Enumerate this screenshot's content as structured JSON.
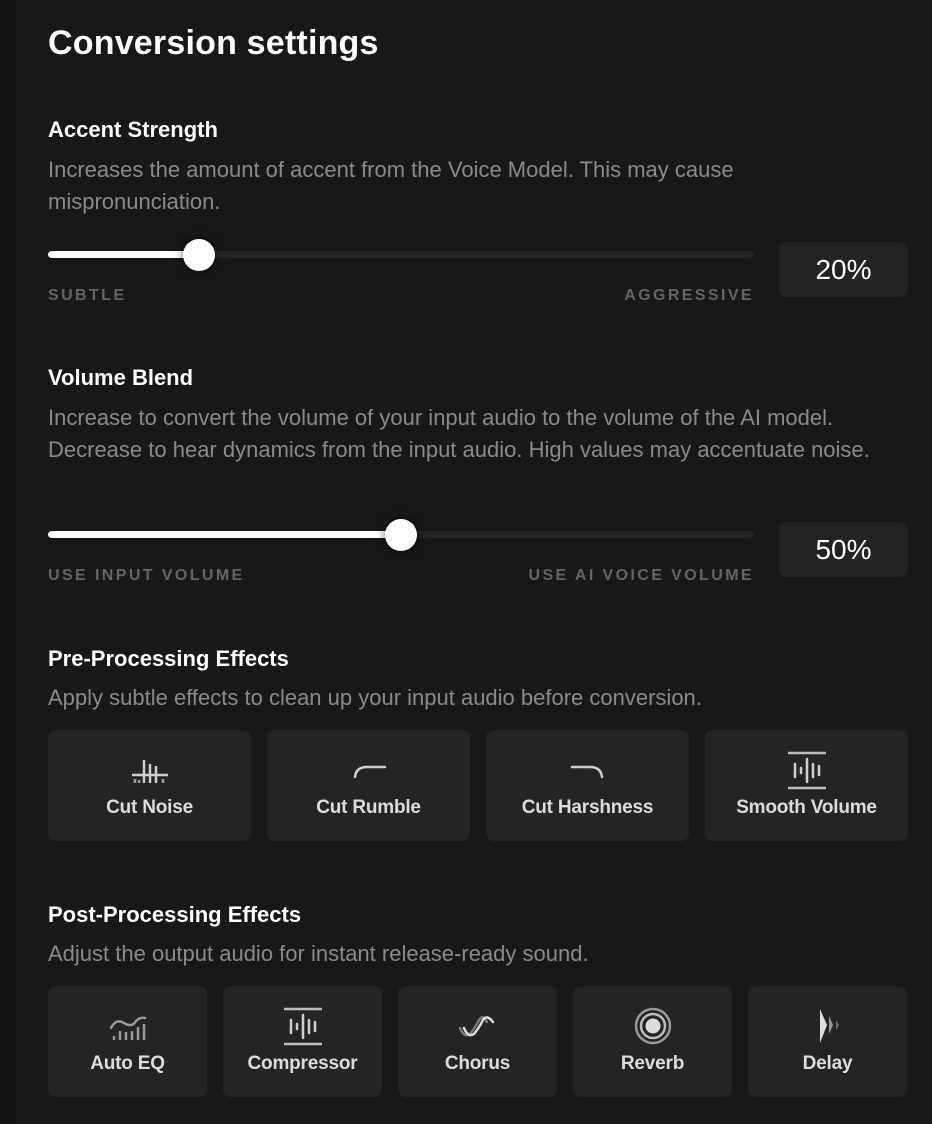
{
  "header": {
    "title": "Conversion settings"
  },
  "accent_strength": {
    "title": "Accent Strength",
    "description": "Increases the amount of accent from the Voice Model. This may cause mispronunciation.",
    "value_percent": 20,
    "value_label": "20%",
    "min_label": "SUBTLE",
    "max_label": "AGGRESSIVE"
  },
  "volume_blend": {
    "title": "Volume Blend",
    "description": "Increase to convert the volume of your input audio to the volume of the AI model. Decrease to hear dynamics from the input audio. High values may accentuate noise.",
    "value_percent": 50,
    "value_label": "50%",
    "min_label": "USE INPUT VOLUME",
    "max_label": "USE AI VOICE VOLUME"
  },
  "pre_processing": {
    "title": "Pre-Processing Effects",
    "description": "Apply subtle effects to clean up your input audio before conversion.",
    "effects": [
      {
        "label": "Cut Noise",
        "icon": "noise-gate-icon"
      },
      {
        "label": "Cut Rumble",
        "icon": "high-pass-curve-icon"
      },
      {
        "label": "Cut Harshness",
        "icon": "low-pass-curve-icon"
      },
      {
        "label": "Smooth Volume",
        "icon": "compressed-waveform-icon"
      }
    ]
  },
  "post_processing": {
    "title": "Post-Processing Effects",
    "description": "Adjust the output audio for instant release-ready sound.",
    "effects": [
      {
        "label": "Auto EQ",
        "icon": "eq-bars-curve-icon"
      },
      {
        "label": "Compressor",
        "icon": "compressed-waveform-icon"
      },
      {
        "label": "Chorus",
        "icon": "double-wave-icon"
      },
      {
        "label": "Reverb",
        "icon": "concentric-circles-icon"
      },
      {
        "label": "Delay",
        "icon": "echo-triangles-icon"
      }
    ]
  },
  "colors": {
    "background": "#181818",
    "card": "#242424",
    "text_primary": "#ffffff",
    "text_secondary": "#8a8a8a",
    "label_muted": "#646464",
    "slider_fill": "#ffffff",
    "slider_track": "#252525"
  }
}
